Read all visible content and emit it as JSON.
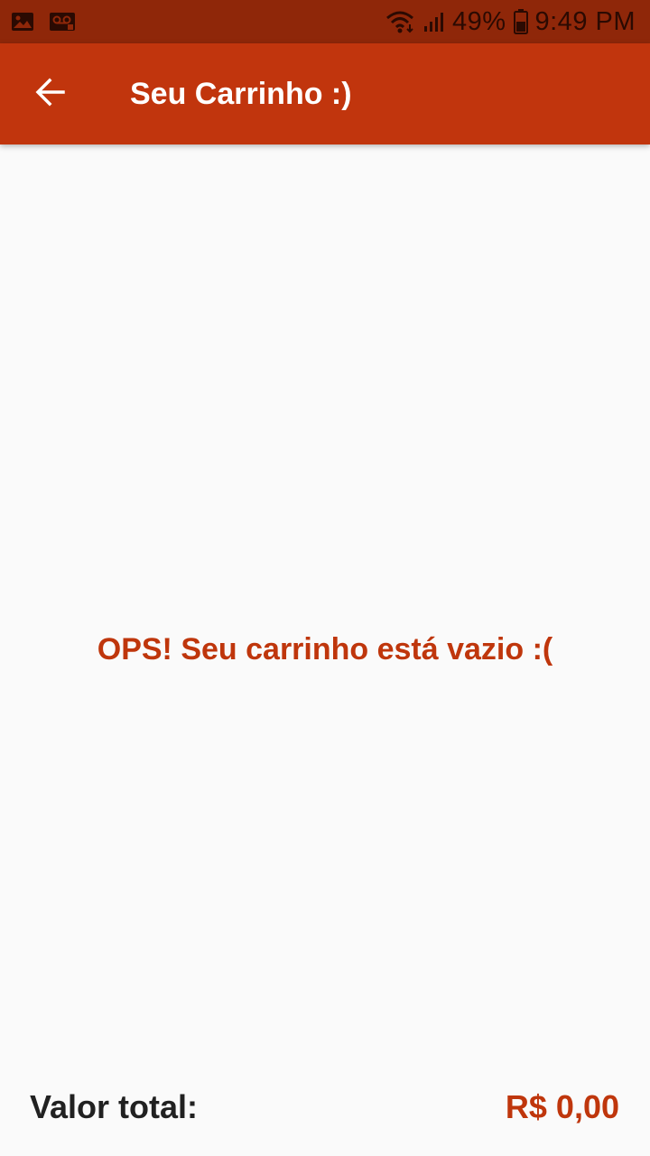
{
  "status_bar": {
    "battery_percent": "49%",
    "time": "9:49 PM",
    "left_icons": [
      "image-notification-icon",
      "voicemail-icon"
    ],
    "right_icons": [
      "wifi-icon",
      "signal-icon",
      "battery-icon"
    ]
  },
  "app_bar": {
    "title": "Seu Carrinho :)",
    "back_icon": "arrow-back-icon"
  },
  "cart": {
    "empty_message": "OPS! Seu carrinho está vazio :("
  },
  "footer": {
    "total_label": "Valor total:",
    "total_value": "R$ 0,00"
  },
  "colors": {
    "status_bar": "#8f2709",
    "app_bar": "#c1350d",
    "accent_text": "#bf360c",
    "background": "#fafafa"
  }
}
